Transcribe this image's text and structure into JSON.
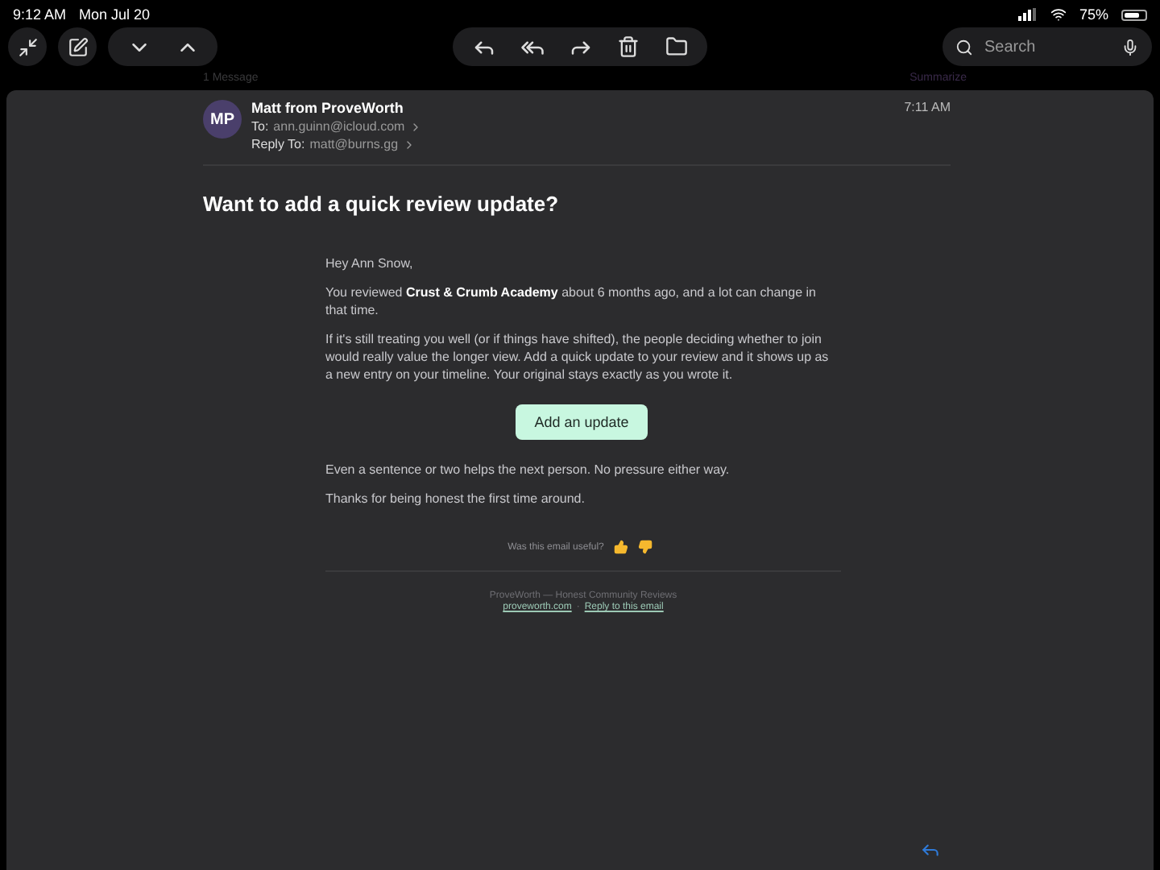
{
  "status_bar": {
    "time": "9:12 AM",
    "date": "Mon Jul 20",
    "battery": "75%"
  },
  "toolbar": {
    "search": {
      "placeholder": "Search"
    }
  },
  "thread": {
    "count": "1 Message",
    "summarize": "Summarize"
  },
  "message": {
    "avatar": "MP",
    "sender": "Matt from ProveWorth",
    "to_label": "To:",
    "to": "ann.guinn@icloud.com",
    "reply_to_label": "Reply To:",
    "reply_to": "matt@burns.gg",
    "time": "7:11 AM",
    "subject": "Want to add a quick review update?"
  },
  "body": {
    "greeting": "Hey Ann Snow,",
    "paragraphs": [
      "You reviewed **Crust & Crumb Academy** about 6 months ago, and a lot can change in that time.",
      "If it's still treating you well (or if things have shifted), the people deciding whether to join would really value the longer view. Add a quick update to your review and it shows up as a new entry on your timeline. Your original stays exactly as you wrote it."
    ],
    "button": "Add an update",
    "closing": [
      "Even a sentence or two helps the next person. No pressure either way.",
      "Thanks for being honest the first time around."
    ],
    "feedback": "Was this email useful?",
    "footer": {
      "tagline": "ProveWorth — Honest Community Reviews",
      "links": [
        "proveworth.com",
        "Reply to this email"
      ],
      "separator": "·"
    }
  }
}
